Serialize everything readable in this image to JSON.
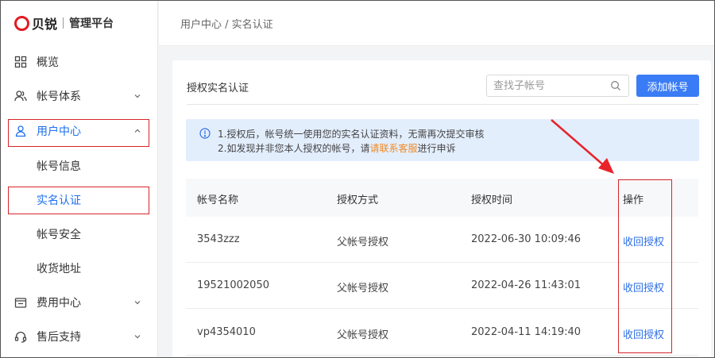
{
  "logo": {
    "brand": "贝锐",
    "subtitle": "管理平台"
  },
  "sidebar": {
    "items": [
      {
        "label": "概览",
        "icon": "grid-icon"
      },
      {
        "label": "帐号体系",
        "icon": "users-icon"
      },
      {
        "label": "用户中心",
        "icon": "user-icon"
      },
      {
        "label": "帐号信息"
      },
      {
        "label": "实名认证"
      },
      {
        "label": "帐号安全"
      },
      {
        "label": "收货地址"
      },
      {
        "label": "费用中心",
        "icon": "wallet-icon"
      },
      {
        "label": "售后支持",
        "icon": "headset-icon"
      }
    ]
  },
  "breadcrumb": "用户中心 / 实名认证",
  "card": {
    "title": "授权实名认证",
    "search_placeholder": "查找子帐号",
    "add_button": "添加帐号"
  },
  "notice": {
    "line1": "1.授权后，帐号统一使用您的实名认证资料，无需再次提交审核",
    "line2_prefix": "2.如发现并非您本人授权的帐号，请",
    "line2_link": "请联系客服",
    "line2_suffix": "进行申诉"
  },
  "table": {
    "headers": [
      "帐号名称",
      "授权方式",
      "授权时间",
      "操作"
    ],
    "rows": [
      {
        "account": "3543zzz",
        "method": "父帐号授权",
        "time": "2022-06-30 10:09:46",
        "action": "收回授权"
      },
      {
        "account": "19521002050",
        "method": "父帐号授权",
        "time": "2022-04-26 11:43:01",
        "action": "收回授权"
      },
      {
        "account": "vp4354010",
        "method": "父帐号授权",
        "time": "2022-04-11 14:19:40",
        "action": "收回授权"
      }
    ]
  },
  "colors": {
    "accent": "#3a7cf5",
    "highlight": "#d6252b",
    "link": "#f08a24"
  }
}
